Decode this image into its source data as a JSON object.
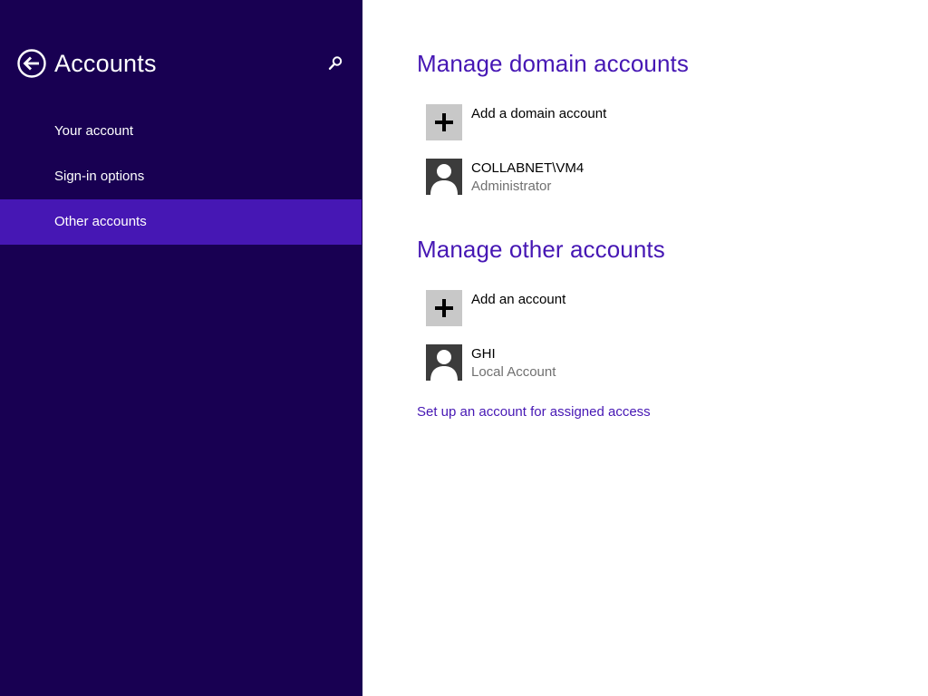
{
  "colors": {
    "sidebar_background": "#180052",
    "selected_item_background": "#4617b4",
    "accent": "#4617b4",
    "subtitle_text": "#707070",
    "add_tile": "#c8c8c8",
    "user_tile": "#3c3c3c"
  },
  "header": {
    "back_icon": "back-arrow-icon",
    "title": "Accounts",
    "search_icon": "search-icon"
  },
  "nav": {
    "items": [
      {
        "label": "Your account",
        "selected": false
      },
      {
        "label": "Sign-in options",
        "selected": false
      },
      {
        "label": "Other accounts",
        "selected": true
      }
    ]
  },
  "domain_section": {
    "heading": "Manage domain accounts",
    "add": {
      "icon": "plus-icon",
      "label": "Add a domain account"
    },
    "accounts": [
      {
        "icon": "user-icon",
        "name": "COLLABNET\\VM4",
        "type": "Administrator"
      }
    ]
  },
  "other_section": {
    "heading": "Manage other accounts",
    "add": {
      "icon": "plus-icon",
      "label": "Add an account"
    },
    "accounts": [
      {
        "icon": "user-icon",
        "name": "GHI",
        "type": "Local Account"
      }
    ]
  },
  "assigned_access_link": "Set up an account for assigned access"
}
